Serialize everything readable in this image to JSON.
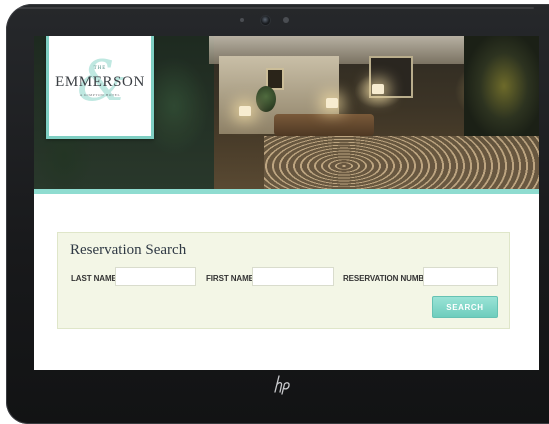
{
  "brand": {
    "the": "THE",
    "name": "EMMERSON",
    "subtitle": "A KIMPTON HOTEL"
  },
  "reservation_search": {
    "title": "Reservation Search",
    "fields": [
      {
        "label": "LAST NAME",
        "value": "",
        "placeholder": ""
      },
      {
        "label": "FIRST NAME",
        "value": "",
        "placeholder": ""
      },
      {
        "label": "RESERVATION NUMBER",
        "value": "",
        "placeholder": ""
      }
    ],
    "search_button": "SEARCH"
  },
  "colors": {
    "accent": "#8fdcd0",
    "button": "#6ecdbd",
    "panel_background": "#f3f6e6"
  },
  "icons": [
    "camera-icon",
    "hp-logo-icon"
  ]
}
